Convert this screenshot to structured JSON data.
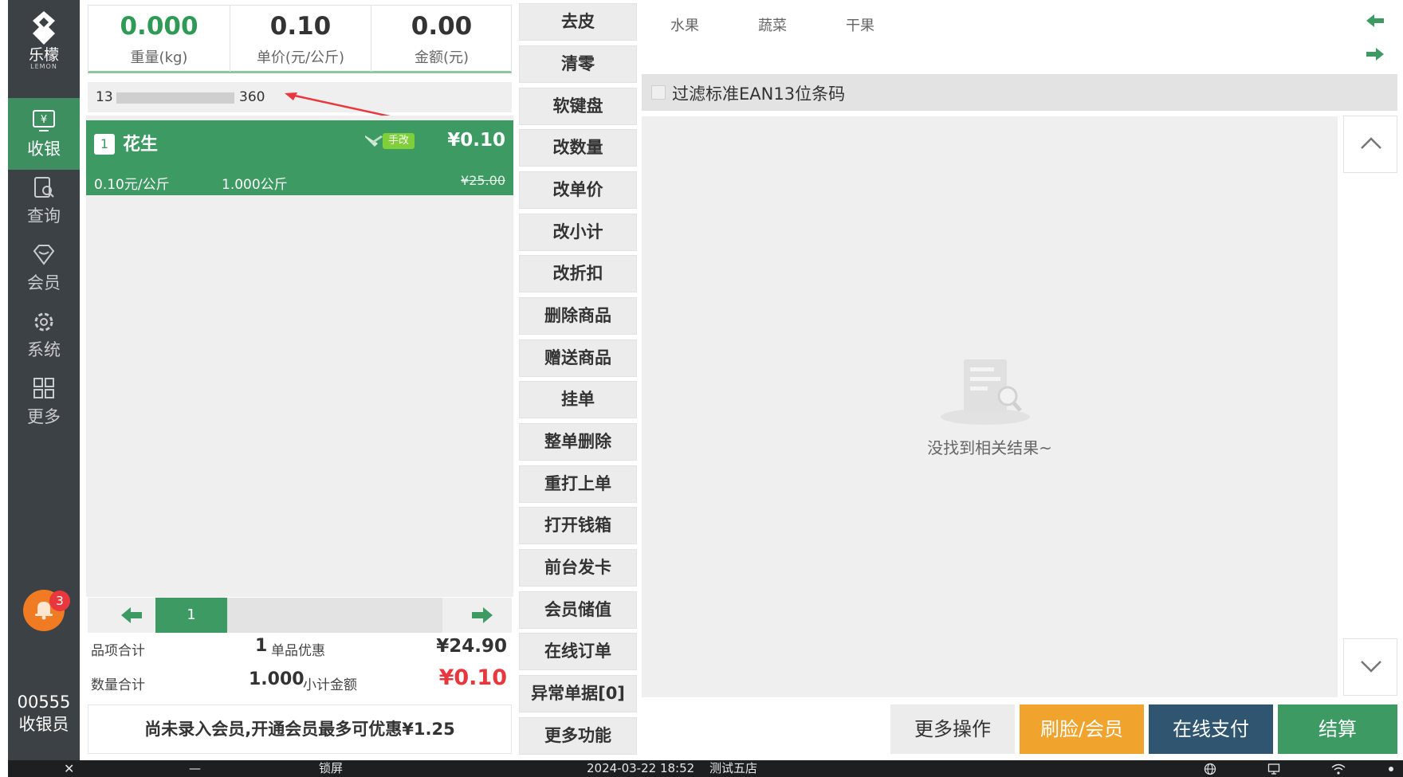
{
  "sidebar": {
    "logo_text": "乐檬",
    "logo_sub": "LEMON",
    "items": [
      {
        "label": "收银",
        "icon": "cashier-icon",
        "active": true
      },
      {
        "label": "查询",
        "icon": "query-icon",
        "active": false
      },
      {
        "label": "会员",
        "icon": "member-icon",
        "active": false
      },
      {
        "label": "系统",
        "icon": "settings-icon",
        "active": false
      },
      {
        "label": "更多",
        "icon": "grid-icon",
        "active": false
      }
    ],
    "notification_count": "3",
    "cashier_no": "00555",
    "cashier_role": "收银员"
  },
  "scale": {
    "weight_value": "0.000",
    "weight_label": "重量(kg)",
    "unit_price_value": "0.10",
    "unit_price_label": "单价(元/公斤)",
    "amount_value": "0.00",
    "amount_label": "金额(元)"
  },
  "barcode": {
    "prefix": "13",
    "suffix": "360"
  },
  "cart": {
    "items": [
      {
        "index": "1",
        "name": "花生",
        "tag": "手改",
        "price": "¥0.10",
        "unit_price": "0.10元/公斤",
        "quantity": "1.000公斤",
        "original_price": "¥25.00"
      }
    ],
    "page": "1"
  },
  "totals": {
    "items_label": "品项合计",
    "items_count": "1",
    "discount_label": "单品优惠",
    "discount_amount": "¥24.90",
    "qty_label": "数量合计",
    "qty_value": "1.000",
    "subtotal_label": "小计金额",
    "subtotal_amount": "¥0.10"
  },
  "member_banner": "尚未录入会员,开通会员最多可优惠¥1.25",
  "functions": [
    "去皮",
    "清零",
    "软键盘",
    "改数量",
    "改单价",
    "改小计",
    "改折扣",
    "删除商品",
    "赠送商品",
    "挂单",
    "整单删除",
    "重打上单",
    "打开钱箱",
    "前台发卡",
    "会员储值",
    "在线订单",
    "异常单据[0]",
    "更多功能"
  ],
  "categories": [
    "水果",
    "蔬菜",
    "干果"
  ],
  "filter_label": "过滤标准EAN13位条码",
  "empty_text": "没找到相关结果~",
  "actions": {
    "more": "更多操作",
    "face_member": "刷脸/会员",
    "online_pay": "在线支付",
    "settle": "结算"
  },
  "taskbar": {
    "close": "✕",
    "minimize": "—",
    "lock": "锁屏",
    "datetime": "2024-03-22 18:52",
    "store": "测试五店"
  },
  "colors": {
    "sidebar": "#3c4146",
    "accent_green": "#3e9a63",
    "orange": "#f0a32d",
    "navy": "#2f5570",
    "red": "#e8383d"
  }
}
